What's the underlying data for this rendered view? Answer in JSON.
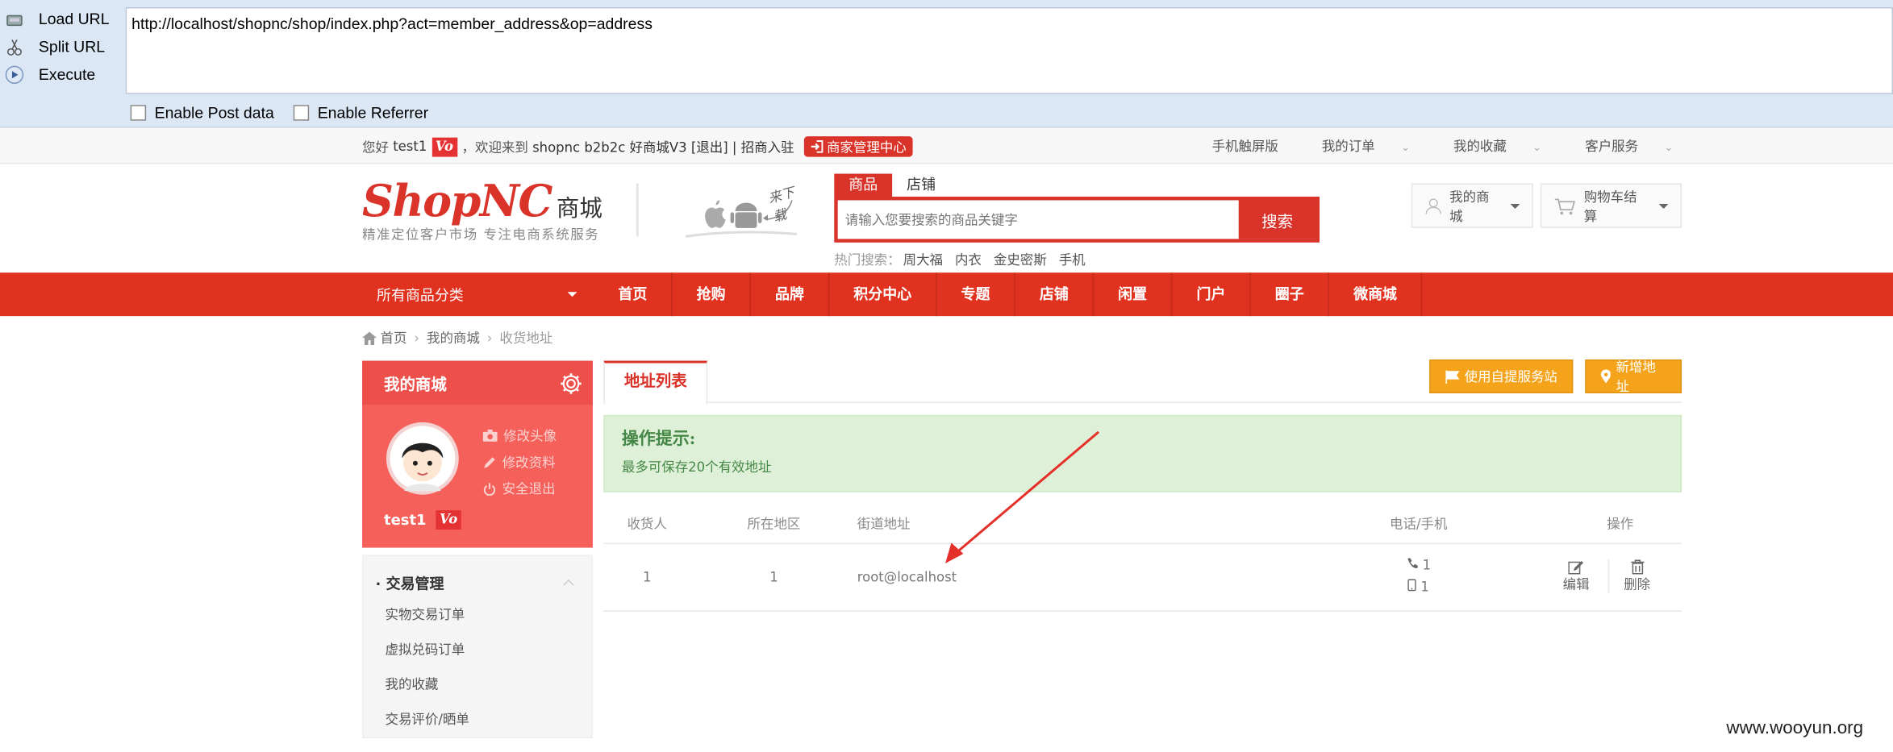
{
  "hackbar": {
    "load_url": "Load URL",
    "split_url": "Split URL",
    "execute": "Execute",
    "url": "http://localhost/shopnc/shop/index.php?act=member_address&op=address",
    "enable_post": "Enable Post data",
    "enable_referrer": "Enable Referrer"
  },
  "topbar": {
    "greeting": "您好",
    "username": "test1",
    "vo": "Vo",
    "welcome": "，欢迎来到",
    "site": "shopnc b2b2c 好商城V3",
    "logout": "[退出]",
    "join": "| 招商入驻",
    "seller_center": "商家管理中心",
    "right_links": [
      "手机触屏版",
      "我的订单",
      "我的收藏",
      "客户服务"
    ]
  },
  "header": {
    "brand": "ShopNC",
    "brand_cn": "商城",
    "slogan": "精准定位客户市场 专注电商系统服务",
    "app_label": "来下载",
    "search_tabs": [
      "商品",
      "店铺"
    ],
    "search_placeholder": "请输入您要搜索的商品关键字",
    "search_button": "搜索",
    "hot_label": "热门搜索：",
    "hot_words": [
      "周大福",
      "内衣",
      "金史密斯",
      "手机"
    ],
    "my_mall": "我的商城",
    "cart": "购物车结算"
  },
  "nav": {
    "all_categories": "所有商品分类",
    "items": [
      "首页",
      "抢购",
      "品牌",
      "积分中心",
      "专题",
      "店铺",
      "闲置",
      "门户",
      "圈子",
      "微商城"
    ]
  },
  "breadcrumb": [
    "首页",
    "我的商城",
    "收货地址"
  ],
  "sidebar": {
    "title": "我的商城",
    "links": [
      "修改头像",
      "修改资料",
      "安全退出"
    ],
    "username": "test1",
    "vo": "Vo",
    "group": "交易管理",
    "group_prefix": "·",
    "items": [
      "实物交易订单",
      "虚拟兑码订单",
      "我的收藏",
      "交易评价/晒单"
    ]
  },
  "main": {
    "tab": "地址列表",
    "btn_pickup": "使用自提服务站",
    "btn_new": "新增地址",
    "tip_title": "操作提示:",
    "tip_text": "最多可保存20个有效地址",
    "columns": [
      "收货人",
      "所在地区",
      "街道地址",
      "电话/手机",
      "操作"
    ],
    "rows": [
      {
        "name": "1",
        "region": "1",
        "street": "root@localhost",
        "phone": "1",
        "mobile": "1",
        "edit": "编辑",
        "delete": "删除"
      }
    ]
  },
  "watermark": "www.wooyun.org",
  "colors": {
    "brand_red": "#e0321f",
    "orange": "#f4a31b",
    "tip_green": "#dff0d8"
  }
}
